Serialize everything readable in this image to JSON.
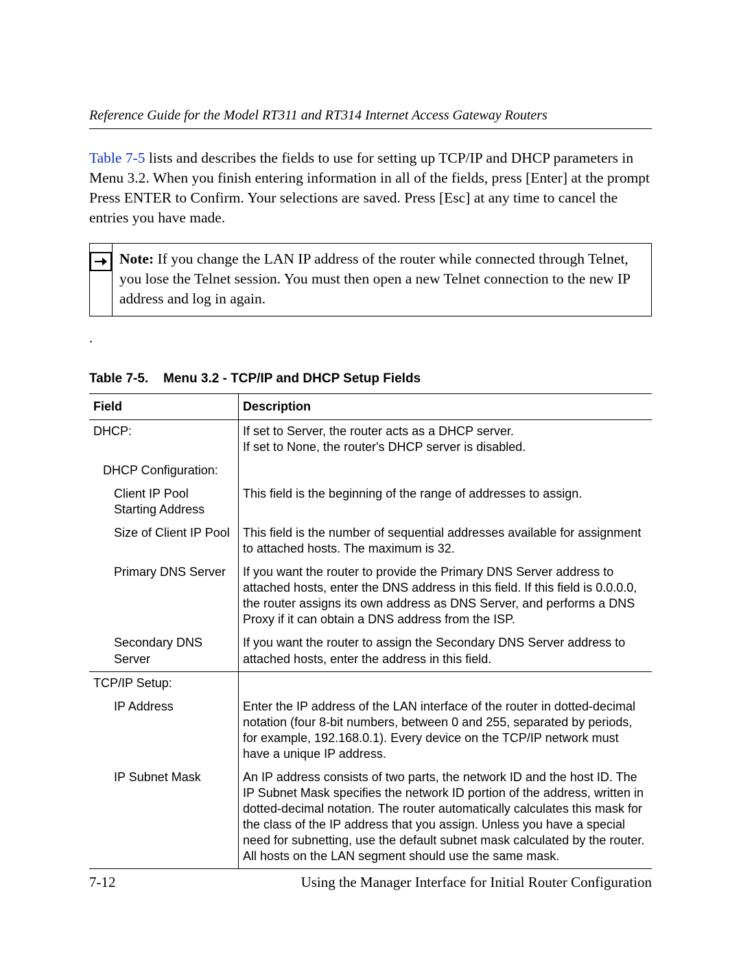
{
  "header": {
    "running_title": "Reference Guide for the Model RT311 and RT314 Internet Access Gateway Routers"
  },
  "intro": {
    "link_text": "Table 7-5",
    "rest": " lists and describes the fields to use for setting up TCP/IP and DHCP parameters in Menu 3.2. When you finish entering information in all of the fields, press [Enter] at the prompt Press ENTER to Confirm. Your selections are saved. Press [Esc] at any time to cancel the entries you have made."
  },
  "note": {
    "label": "Note:",
    "text": " If you change the LAN IP address of the router while connected through Telnet, you lose the Telnet session. You must then open a new Telnet connection to the new IP address and log in again."
  },
  "dot": ".",
  "table": {
    "caption_number": "Table 7-5.",
    "caption_title": "Menu 3.2 - TCP/IP and DHCP Setup Fields",
    "head_field": "Field",
    "head_desc": "Description",
    "rows": [
      {
        "field": "DHCP:",
        "indent": 0,
        "desc": "If set to Server, the router acts as a DHCP server.\nIf set to None, the router's DHCP server is disabled."
      },
      {
        "field": "DHCP Configuration:",
        "indent": 1,
        "desc": ""
      },
      {
        "field": "Client IP Pool Starting Address",
        "indent": 2,
        "desc": "This field is the beginning of the range of addresses to assign."
      },
      {
        "field": "Size of Client IP Pool",
        "indent": 2,
        "desc": "This field is the number of sequential addresses available for assignment to attached hosts. The maximum is 32."
      },
      {
        "field": "Primary DNS Server",
        "indent": 2,
        "desc": "If you want the router to provide the Primary DNS Server address to attached hosts, enter the DNS address in this field. If this field is 0.0.0.0, the router assigns its own address as DNS Server, and performs a DNS Proxy if it can obtain a DNS address from the ISP."
      },
      {
        "field": "Secondary DNS Server",
        "indent": 2,
        "desc": "If you want the router to assign the Secondary DNS Server address to attached hosts, enter the address in this field.",
        "sep": true
      },
      {
        "field": "TCP/IP Setup:",
        "indent": 0,
        "desc": ""
      },
      {
        "field": "IP Address",
        "indent": 2,
        "desc": "Enter the IP address of the LAN interface of the router in dotted-decimal notation (four 8-bit numbers, between 0 and 255, separated by periods, for example, 192.168.0.1). Every device on the TCP/IP network must have a unique IP address."
      },
      {
        "field": "IP Subnet Mask",
        "indent": 2,
        "desc": "An IP address consists of two parts, the network ID and the host ID. The IP Subnet Mask specifies the network ID portion of the address, written in dotted-decimal notation. The router automatically calculates this mask for the class of the IP address that you assign. Unless you have a special need for subnetting, use the default subnet mask calculated by the router. All hosts on the LAN segment should use the same mask."
      }
    ]
  },
  "footer": {
    "page_num": "7-12",
    "section": "Using the Manager Interface for Initial Router Configuration"
  }
}
